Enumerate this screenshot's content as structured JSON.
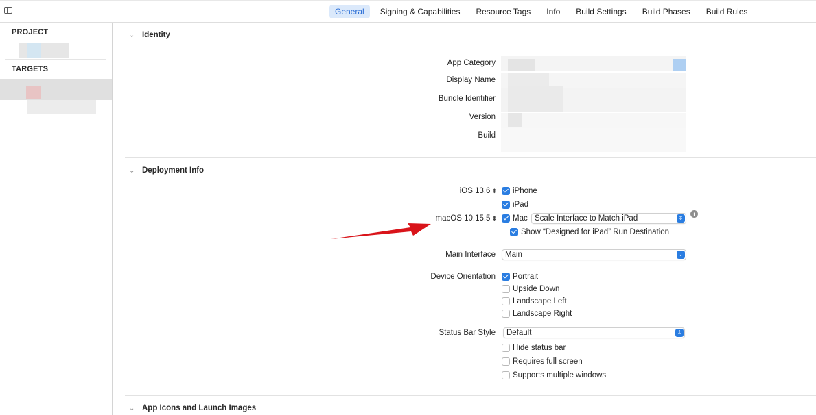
{
  "tabs": [
    {
      "label": "General",
      "active": true
    },
    {
      "label": "Signing & Capabilities"
    },
    {
      "label": "Resource Tags"
    },
    {
      "label": "Info"
    },
    {
      "label": "Build Settings"
    },
    {
      "label": "Build Phases"
    },
    {
      "label": "Build Rules"
    }
  ],
  "sidebar": {
    "project_header": "PROJECT",
    "targets_header": "TARGETS"
  },
  "identity": {
    "title": "Identity",
    "labels": {
      "app_category": "App Category",
      "display_name": "Display Name",
      "bundle_identifier": "Bundle Identifier",
      "version": "Version",
      "build": "Build"
    }
  },
  "deployment": {
    "title": "Deployment Info",
    "ios_version": "iOS 13.6",
    "macos_version": "macOS 10.15.5",
    "stepper_glyph": "⬍",
    "devices": {
      "iphone": "iPhone",
      "ipad": "iPad",
      "mac": "Mac"
    },
    "mac_scale_value": "Scale Interface to Match iPad",
    "show_designed": "Show “Designed for iPad” Run Destination",
    "main_interface_label": "Main Interface",
    "main_interface_value": "Main",
    "device_orientation_label": "Device Orientation",
    "orientations": {
      "portrait": "Portrait",
      "upside_down": "Upside Down",
      "landscape_left": "Landscape Left",
      "landscape_right": "Landscape Right"
    },
    "status_bar_style_label": "Status Bar Style",
    "status_bar_style_value": "Default",
    "hide_status_bar": "Hide status bar",
    "requires_full_screen": "Requires full screen",
    "supports_multiple_windows": "Supports multiple windows",
    "info_glyph": "i"
  },
  "app_icons": {
    "title": "App Icons and Launch Images"
  },
  "colors": {
    "accent": "#2a7de1",
    "arrow": "#d9141a",
    "tab_active_bg": "#dbe9fb"
  }
}
